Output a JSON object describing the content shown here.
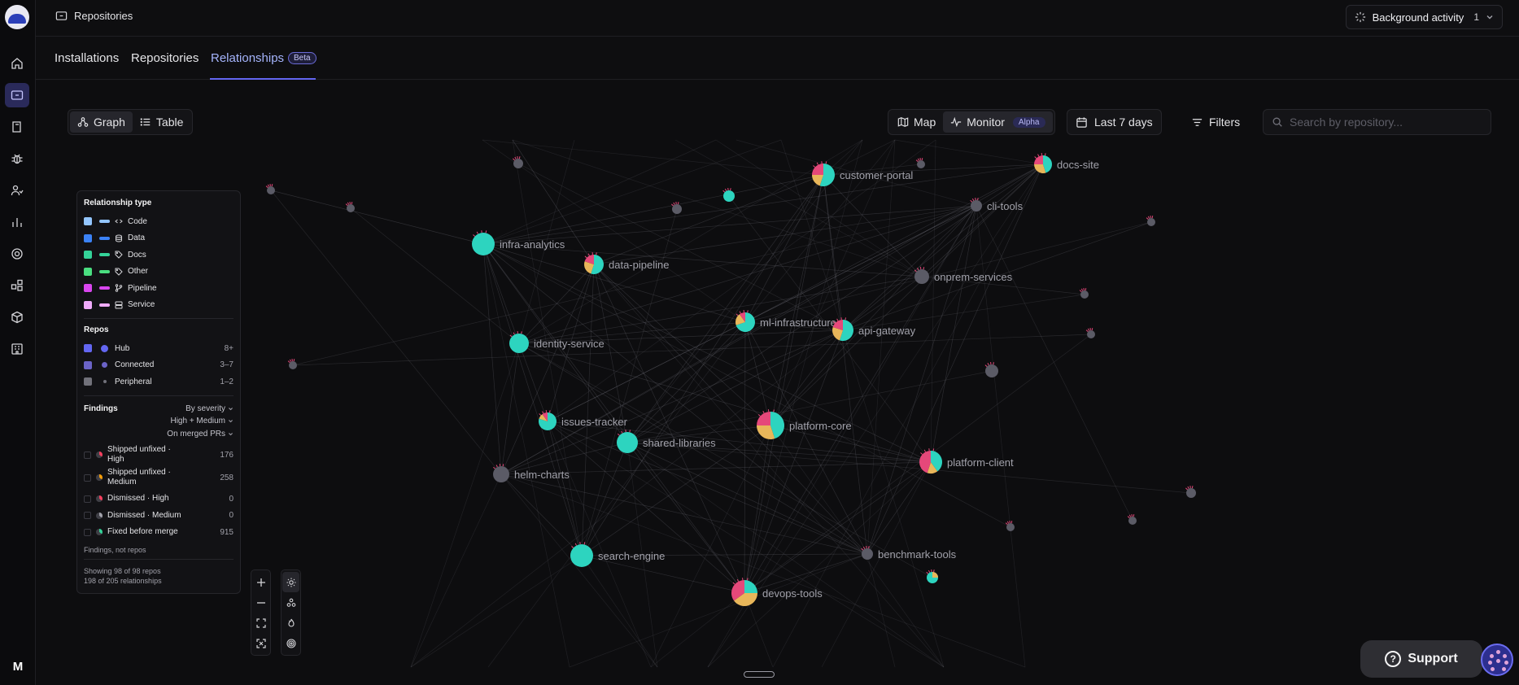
{
  "sidebar": {
    "icons": [
      "home-icon",
      "repositories-icon",
      "book-icon",
      "bug-icon",
      "users-icon",
      "chart-icon",
      "target-icon",
      "integrations-icon",
      "package-icon",
      "building-icon"
    ],
    "active": "repositories-icon",
    "avatar_initial": "M"
  },
  "header": {
    "breadcrumb": "Repositories",
    "background_activity": {
      "label": "Background activity",
      "count": "1"
    }
  },
  "tabs": [
    {
      "label": "Installations"
    },
    {
      "label": "Repositories"
    },
    {
      "label": "Relationships",
      "badge": "Beta",
      "active": true
    }
  ],
  "view_toggle": {
    "graph": "Graph",
    "table": "Table",
    "active": "Graph"
  },
  "mode_toggle": {
    "map": "Map",
    "monitor": "Monitor",
    "monitor_badge": "Alpha",
    "active": "Monitor"
  },
  "date_range": "Last 7 days",
  "filters_label": "Filters",
  "search": {
    "placeholder": "Search by repository..."
  },
  "legend": {
    "relationship_title": "Relationship type",
    "relationship_types": [
      {
        "label": "Code",
        "color": "#93c5fd",
        "icon": "code-icon"
      },
      {
        "label": "Data",
        "color": "#3b82f6",
        "icon": "database-icon"
      },
      {
        "label": "Docs",
        "color": "#34d399",
        "icon": "tag-icon"
      },
      {
        "label": "Other",
        "color": "#4ade80",
        "icon": "tag-icon"
      },
      {
        "label": "Pipeline",
        "color": "#d946ef",
        "icon": "branch-icon"
      },
      {
        "label": "Service",
        "color": "#f0abfc",
        "icon": "server-icon"
      }
    ],
    "repos_title": "Repos",
    "repos": [
      {
        "label": "Hub",
        "count": "8+",
        "color": "#6366f1"
      },
      {
        "label": "Connected",
        "count": "3–7",
        "color": "#6b63c7"
      },
      {
        "label": "Peripheral",
        "count": "1–2",
        "color": "#71717a"
      }
    ],
    "findings_title": "Findings",
    "findings_by": "By severity",
    "findings_level": "High + Medium",
    "findings_scope": "On merged PRs",
    "findings": [
      {
        "label": "Shipped unfixed · High",
        "count": "176",
        "color": "#f43f5e"
      },
      {
        "label": "Shipped unfixed · Medium",
        "count": "258",
        "color": "#f59e0b"
      },
      {
        "label": "Dismissed · High",
        "count": "0",
        "color": "#f43f5e"
      },
      {
        "label": "Dismissed · Medium",
        "count": "0",
        "color": "#a1a1aa"
      },
      {
        "label": "Fixed before merge",
        "count": "915",
        "color": "#34d399"
      }
    ],
    "findings_note": "Findings, not repos",
    "showing_repos": "Showing 98 of 98 repos",
    "showing_relationships": "198 of 205 relationships"
  },
  "graph_nodes": [
    {
      "name": "customer-portal",
      "kind": "hub"
    },
    {
      "name": "docs-site",
      "kind": "hub"
    },
    {
      "name": "cli-tools",
      "kind": "peripheral"
    },
    {
      "name": "infra-analytics",
      "kind": "hub"
    },
    {
      "name": "data-pipeline",
      "kind": "hub"
    },
    {
      "name": "onprem-services",
      "kind": "peripheral"
    },
    {
      "name": "ml-infrastructure",
      "kind": "hub"
    },
    {
      "name": "api-gateway",
      "kind": "hub"
    },
    {
      "name": "identity-service",
      "kind": "hub"
    },
    {
      "name": "issues-tracker",
      "kind": "hub"
    },
    {
      "name": "platform-core",
      "kind": "hub"
    },
    {
      "name": "shared-libraries",
      "kind": "hub"
    },
    {
      "name": "platform-client",
      "kind": "hub"
    },
    {
      "name": "helm-charts",
      "kind": "peripheral"
    },
    {
      "name": "benchmark-tools",
      "kind": "peripheral"
    },
    {
      "name": "search-engine",
      "kind": "hub"
    },
    {
      "name": "devops-tools",
      "kind": "hub"
    }
  ],
  "support_label": "Support"
}
